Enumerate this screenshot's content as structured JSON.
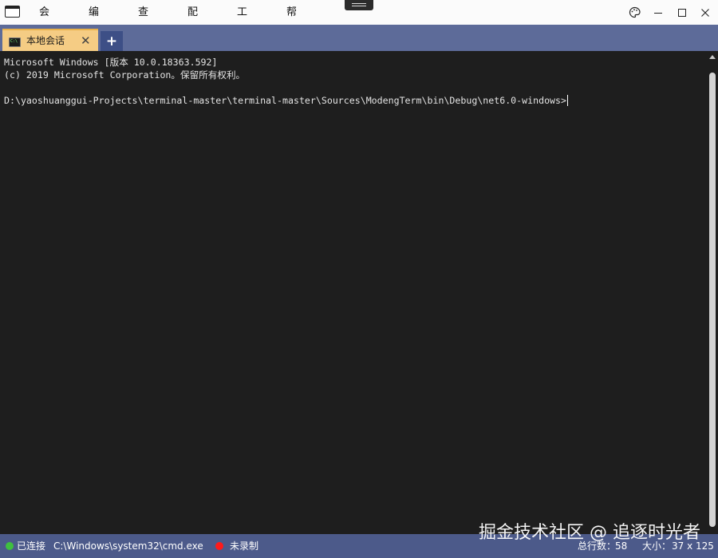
{
  "menu": {
    "items": [
      "会话",
      "编辑",
      "查看",
      "配置",
      "工具",
      "帮助"
    ]
  },
  "window_controls": {
    "icons": [
      "palette-icon",
      "minimize-icon",
      "maximize-icon",
      "close-icon"
    ]
  },
  "tabs": [
    {
      "label": "本地会话",
      "active": true
    }
  ],
  "add_tab_label": "+",
  "terminal": {
    "lines": [
      "Microsoft Windows [版本 10.0.18363.592]",
      "(c) 2019 Microsoft Corporation。保留所有权利。",
      "",
      "D:\\yaoshuanggui-Projects\\terminal-master\\terminal-master\\Sources\\ModengTerm\\bin\\Debug\\net6.0-windows>"
    ]
  },
  "statusbar": {
    "connection_status": "已连接",
    "process_path": "C:\\Windows\\system32\\cmd.exe",
    "record_status": "未录制",
    "total_lines_label": "总行数：",
    "total_lines": "58",
    "size_label": "大小：",
    "size_value": "37 x 125"
  },
  "watermark": "掘金技术社区 @ 追逐时光者",
  "colors": {
    "tab_active": "#f5cc84",
    "tabbar": "#5d6b99",
    "statusbar": "#4c5a8a",
    "terminal_bg": "#1e1e1e",
    "connected": "#3fbf3f",
    "recording": "#ff1a1a"
  }
}
